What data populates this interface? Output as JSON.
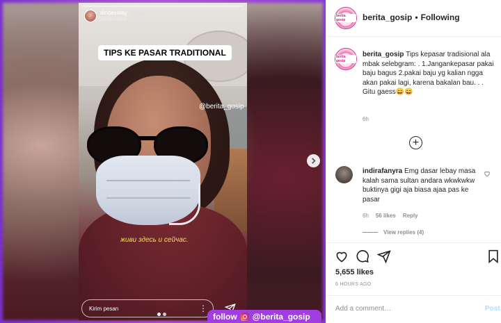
{
  "story": {
    "username": "dindasafay",
    "time": "24 jam",
    "subtitle": "life.with.kuliha",
    "title_sticker": "TIPS KE PASAR TRADITIONAL",
    "watermark": "@berita_gosip",
    "caption_text": "живи здесь и сейчас.",
    "reply_placeholder": "Kirim pesan"
  },
  "promo": {
    "follow_label": "follow",
    "handle": "@berita_gosip",
    "color": "#a23de2"
  },
  "header": {
    "username": "berita_gosip",
    "dot": "•",
    "follow_status": "Following",
    "avatar_text": "berita gosip"
  },
  "caption": {
    "username": "berita_gosip",
    "text": "Tips kepasar tradisional ala mbak selebgram: . 1.Jangankepasar pakai baju bagus 2.pakai baju yg kalian ngga akan pakai lagi, karena bakalan bau. . . Gitu gaess😄😄",
    "time": "6h"
  },
  "load_more": "+",
  "comment": {
    "username": "indirafanyra",
    "text": "Emg dasar lebay masa kalah sama sultan andara wkwkwkw buktinya gigi aja biasa ajaa pas ke pasar",
    "time": "6h",
    "likes": "56 likes",
    "reply_label": "Reply",
    "view_replies": "View replies (4)"
  },
  "likes": "5,655 likes",
  "post_date": "6 HOURS AGO",
  "add_comment": {
    "placeholder": "Add a comment…",
    "post_label": "Post"
  },
  "icons": [
    "heart-icon",
    "comment-icon",
    "share-icon",
    "bookmark-icon",
    "chevron-right-icon",
    "plus-circle-icon",
    "send-icon",
    "more-icon",
    "instagram-icon"
  ]
}
